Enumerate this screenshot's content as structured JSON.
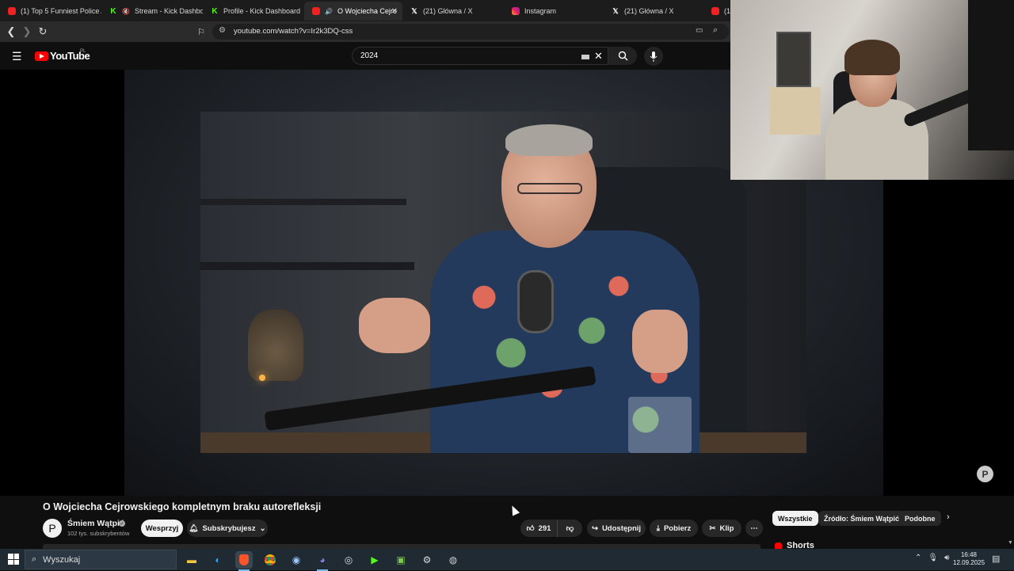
{
  "browser": {
    "tabs": [
      {
        "label": "(1) Top 5 Funniest Police A",
        "favicon": "youtube-icon"
      },
      {
        "label": "Stream - Kick Dashboa",
        "favicon": "kick-icon",
        "muted": true
      },
      {
        "label": "Profile - Kick Dashboard",
        "favicon": "kick-icon"
      },
      {
        "label": "O Wojciecha Cejro",
        "favicon": "youtube-icon",
        "active": true
      },
      {
        "label": "(21) Główna / X",
        "favicon": "x-icon"
      },
      {
        "label": "Instagram",
        "favicon": "instagram-icon"
      },
      {
        "label": "(21) Główna / X",
        "favicon": "x-icon"
      },
      {
        "label": "(1)",
        "favicon": "youtube-icon"
      }
    ],
    "url": "youtube.com/watch?v=Ir2k3DQ-css",
    "close_glyph": "✕"
  },
  "youtube": {
    "logo_text": "YouTube",
    "region": "PL",
    "search_value": "2024",
    "brand_color": "#ff0000"
  },
  "video": {
    "title": "O Wojciecha Cejrowskiego kompletnym braku autorefleksji",
    "overlay_avatar": "P"
  },
  "channel": {
    "avatar_letter": "P",
    "name": "Śmiem Wątpić",
    "subscribers": "102 tys. subskrybentów",
    "support_label": "Wesprzyj",
    "subscribed_label": "Subskrybujesz"
  },
  "actions": {
    "likes": "291",
    "share_label": "Udostępnij",
    "download_label": "Pobierz",
    "clip_label": "Klip"
  },
  "chips": {
    "all": "Wszystkie",
    "source": "Źródło: Śmiem Wątpić",
    "related": "Podobne"
  },
  "shorts_label": "Shorts",
  "taskbar": {
    "search_placeholder": "Wyszukaj",
    "apps": [
      "file-explorer-icon",
      "edge-icon",
      "brave-icon",
      "chrome-icon",
      "steam-icon",
      "discord-icon",
      "obs-icon",
      "kick-icon",
      "game-app-icon",
      "settings-icon",
      "vpn-icon"
    ],
    "time": "16:48",
    "date": "12.09.2025"
  }
}
